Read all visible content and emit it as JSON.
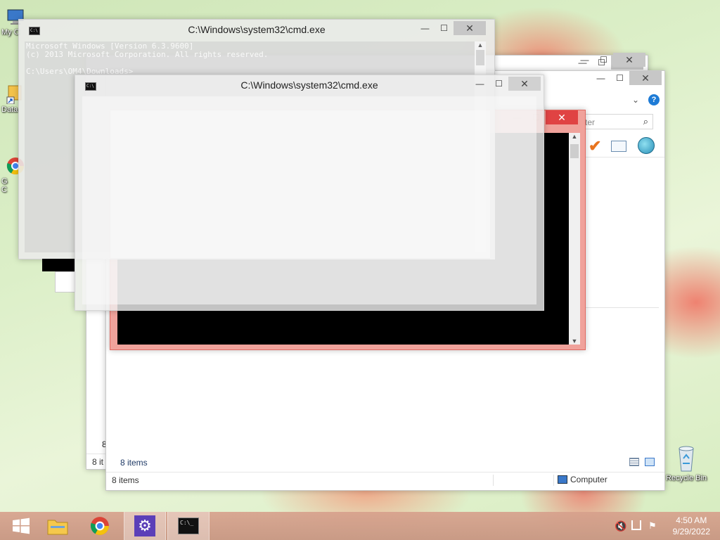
{
  "desktop": {
    "icons": [
      {
        "label": "My C"
      },
      {
        "label": "Data"
      },
      {
        "label": "G"
      },
      {
        "label": "C"
      },
      {
        "label": "Recycle Bin"
      }
    ]
  },
  "cmd_window_1": {
    "title": "C:\\Windows\\system32\\cmd.exe",
    "lines": [
      "Microsoft Windows [Version 6.3.9600]",
      "(c) 2013 Microsoft Corporation. All rights reserved.",
      "C:\\Users\\OM4\\Downloads>"
    ]
  },
  "cmd_window_2": {
    "title": "C:\\Windows\\system32\\cmd.exe"
  },
  "explorer_front": {
    "search_placeholder": "ter",
    "status_items": "8 items",
    "status_location": "Computer",
    "inner_status_items": "8 items"
  },
  "explorer_back": {
    "status_items_a": "8 it",
    "status_items_b": "8"
  },
  "window_buttons": {
    "minimize": "—",
    "maximize": "☐",
    "close": "✕"
  },
  "taskbar": {
    "time": "4:50 AM",
    "date": "9/29/2022"
  },
  "colors": {
    "close_active": "#e04343",
    "console_bg": "#000000",
    "active_border": "#ef8078",
    "help_blue": "#1e7bd6"
  }
}
